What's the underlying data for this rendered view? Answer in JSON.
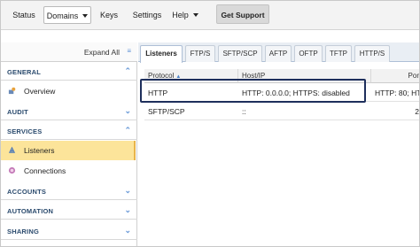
{
  "menubar": {
    "items": [
      "Status",
      "Domains",
      "Keys",
      "Settings",
      "Help"
    ],
    "support_label": "Get Support"
  },
  "sidebar": {
    "expand_all_label": "Expand All",
    "sections": {
      "general": "GENERAL",
      "audit": "AUDIT",
      "services": "SERVICES",
      "accounts": "ACCOUNTS",
      "automation": "AUTOMATION",
      "sharing": "SHARING"
    },
    "items": {
      "overview": "Overview",
      "listeners": "Listeners",
      "connections": "Connections"
    },
    "active_item": "Listeners"
  },
  "tabs": [
    "Listeners",
    "FTP/S",
    "SFTP/SCP",
    "AFTP",
    "OFTP",
    "TFTP",
    "HTTP/S"
  ],
  "active_tab": "Listeners",
  "table": {
    "headers": [
      "Protocol",
      "Host/IP",
      "Por"
    ],
    "sort_column": "Protocol",
    "rows": [
      [
        "HTTP",
        "HTTP: 0.0.0.0; HTTPS: disabled",
        "HTTP: 80; HT..."
      ],
      [
        "SFTP/SCP",
        "::",
        "2"
      ]
    ],
    "highlighted_row": 0
  },
  "colors": {
    "active_item_bg": "#fce49a",
    "section_label": "#2a4a6d",
    "highlight_border": "#1e2f5c",
    "chevron": "#6a9ad8"
  }
}
